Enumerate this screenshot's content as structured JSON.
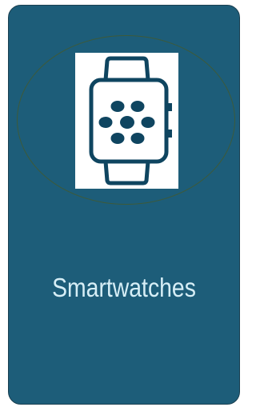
{
  "card": {
    "label": "Smartwatches",
    "icon": "smartwatch-icon"
  },
  "colors": {
    "card_bg": "#1d5d79",
    "label_text": "#d6eef6",
    "icon_fill": "#0f4560"
  }
}
